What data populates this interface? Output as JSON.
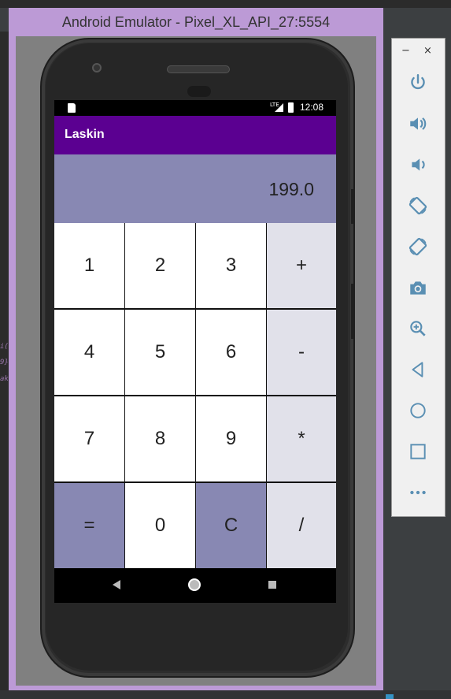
{
  "window": {
    "title": "Android Emulator - Pixel_XL_API_27:5554"
  },
  "status_bar": {
    "network": "LTE",
    "time": "12:08"
  },
  "app": {
    "title": "Laskin",
    "display_value": "199.0"
  },
  "keypad": {
    "keys": [
      "1",
      "2",
      "3",
      "+",
      "4",
      "5",
      "6",
      "-",
      "7",
      "8",
      "9",
      "*",
      "=",
      "0",
      "C",
      "/"
    ]
  },
  "ide": {
    "code_fragments": [
      "i(",
      "9}",
      "ak"
    ]
  },
  "emulator_panel": {
    "minimize_label": "−",
    "close_label": "×",
    "tools": [
      "power-icon",
      "volume-up-icon",
      "volume-down-icon",
      "rotate-left-icon",
      "rotate-right-icon",
      "camera-icon",
      "zoom-icon",
      "back-icon",
      "home-icon",
      "overview-icon",
      "more-icon"
    ]
  },
  "colors": {
    "app_bar": "#5b0091",
    "display_bg": "#8888b3",
    "operator_key": "#e1e1ea",
    "emulator_frame": "#bc9ad6"
  }
}
